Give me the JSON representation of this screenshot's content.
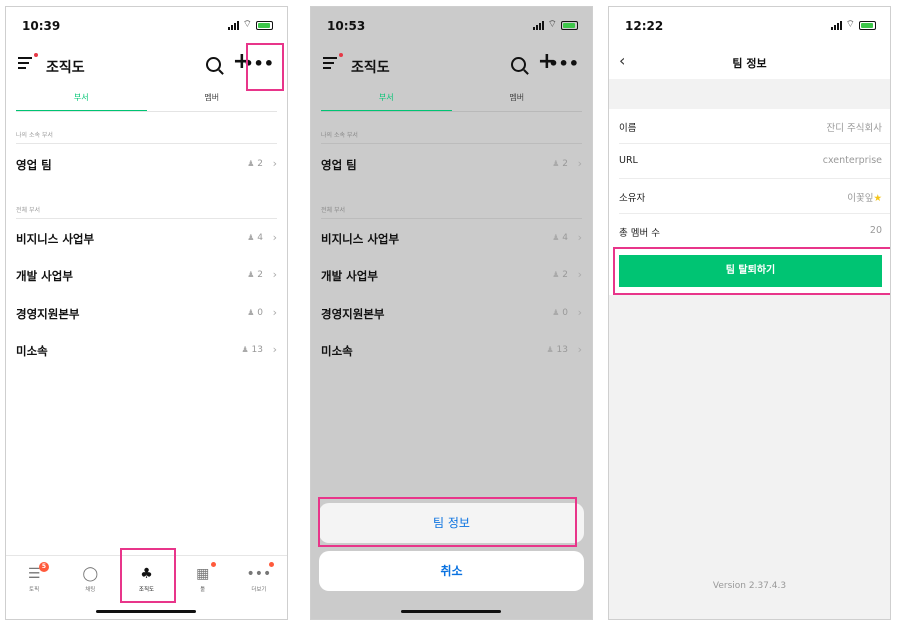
{
  "screen1": {
    "time": "10:39",
    "title": "조직도",
    "tabs": [
      "부서",
      "멤버"
    ],
    "my_section": "나의 소속 부서",
    "all_section": "전체 부서",
    "my_depts": [
      {
        "name": "영업 팀",
        "count": "2"
      }
    ],
    "all_depts": [
      {
        "name": "비지니스 사업부",
        "count": "4"
      },
      {
        "name": "개발 사업부",
        "count": "2"
      },
      {
        "name": "경영지원본부",
        "count": "0"
      },
      {
        "name": "미소속",
        "count": "13"
      }
    ],
    "nav": [
      {
        "label": "토픽",
        "badge": "5"
      },
      {
        "label": "채팅"
      },
      {
        "label": "조직도"
      },
      {
        "label": "툴"
      },
      {
        "label": "더보기"
      }
    ]
  },
  "screen2": {
    "time": "10:53",
    "title": "조직도",
    "tabs": [
      "부서",
      "멤버"
    ],
    "my_section": "나의 소속 부서",
    "all_section": "전체 부서",
    "my_depts": [
      {
        "name": "영업 팀",
        "count": "2"
      }
    ],
    "all_depts": [
      {
        "name": "비지니스 사업부",
        "count": "4"
      },
      {
        "name": "개발 사업부",
        "count": "2"
      },
      {
        "name": "경영지원본부",
        "count": "0"
      },
      {
        "name": "미소속",
        "count": "13"
      }
    ],
    "sheet_option": "팀 정보",
    "cancel": "취소"
  },
  "screen3": {
    "time": "12:22",
    "title": "팀 정보",
    "rows": [
      {
        "key": "이름",
        "value": "잔디 주식회사"
      },
      {
        "key": "URL",
        "value": "cxenterprise"
      },
      {
        "key": "소유자",
        "value": "이꽃잎"
      },
      {
        "key": "총 멤버 수",
        "value": "20"
      }
    ],
    "leave_button": "팀 탈퇴하기",
    "version": "Version 2.37.4.3"
  },
  "colors": {
    "accent": "#00c473",
    "highlight": "#e8358a",
    "link": "#0a72e0",
    "badge": "#ff5a3c"
  }
}
